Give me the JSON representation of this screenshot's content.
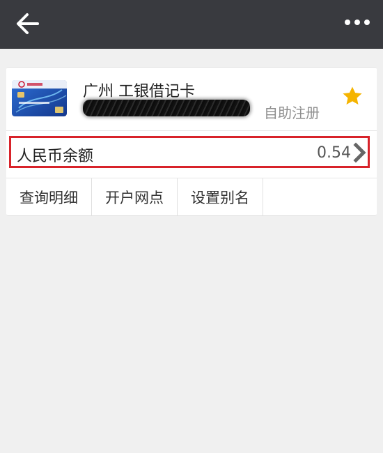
{
  "card": {
    "name": "广州 工银借记卡",
    "register_label": "自助注册"
  },
  "balance": {
    "label": "人民币余额",
    "value": "0.54"
  },
  "actions": [
    {
      "label": "查询明细"
    },
    {
      "label": "开户网点"
    },
    {
      "label": "设置别名"
    }
  ],
  "colors": {
    "topbar": "#393a3f",
    "highlight_border": "#d8232a",
    "star": "#f5b400",
    "card_blue": "#1f56b8"
  }
}
